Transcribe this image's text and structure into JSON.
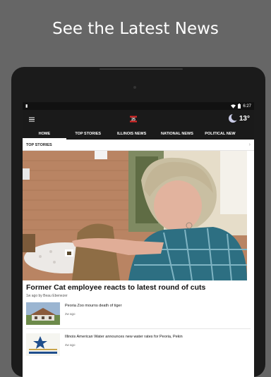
{
  "promo": {
    "title": "See the Latest News"
  },
  "status_bar": {
    "time": "6:27"
  },
  "app_bar": {
    "menu_icon": "hamburger-menu-icon",
    "logo": "channel-25-logo",
    "weather": {
      "icon": "moon-icon",
      "temperature": "13°"
    }
  },
  "tabs": [
    {
      "label": "HOME",
      "active": true
    },
    {
      "label": "TOP STORIES",
      "active": false
    },
    {
      "label": "ILLINOIS NEWS",
      "active": false
    },
    {
      "label": "NATIONAL NEWS",
      "active": false
    },
    {
      "label": "POLITICAL NEW",
      "active": false
    }
  ],
  "section": {
    "title": "TOP STORIES"
  },
  "hero": {
    "headline": "Former Cat employee reacts to latest round of cuts",
    "byline": "1w ago by Beau Ebenezer"
  },
  "stories": [
    {
      "title": "Peoria Zoo mourns death of tiger",
      "time": "2w ago"
    },
    {
      "title": "Illinois American Water announces new water rates for Peoria, Pekin",
      "time": "4w ago"
    }
  ],
  "colors": {
    "background": "#666666",
    "app_bar": "#1a1a1a",
    "accent": "#ffffff"
  }
}
